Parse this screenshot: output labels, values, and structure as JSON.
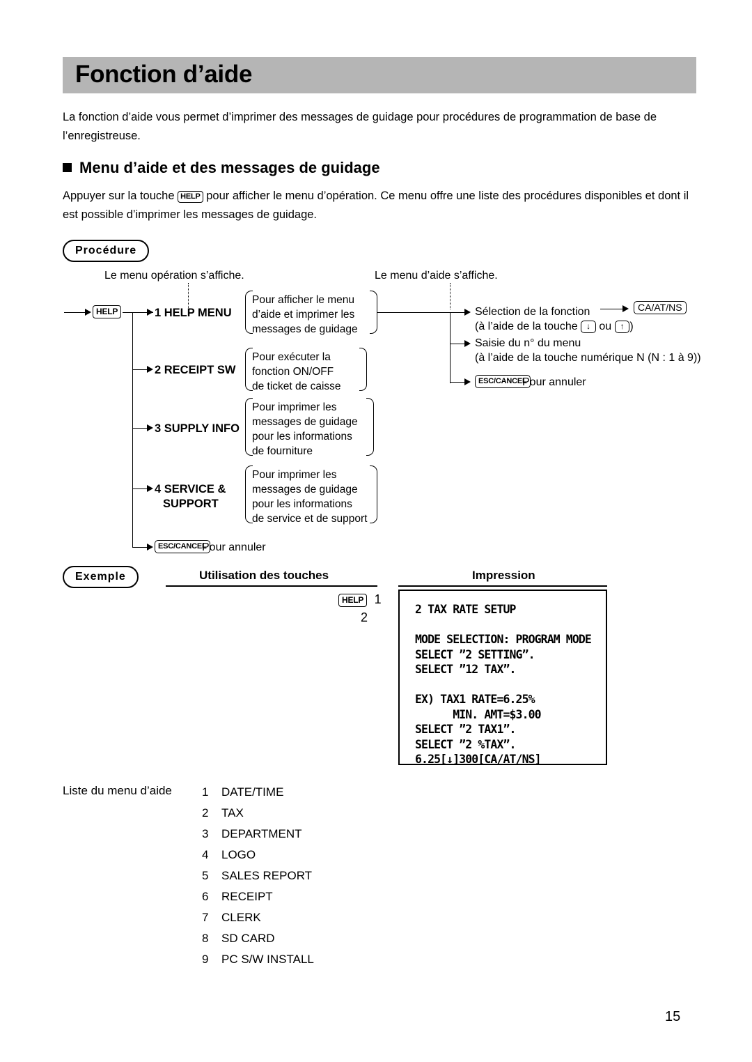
{
  "page": {
    "title": "Fonction d’aide",
    "page_number": "15"
  },
  "intro": {
    "paragraph": "La fonction d’aide vous permet d’imprimer des messages de guidage pour procédures de programmation de base de l’enregistreuse."
  },
  "section": {
    "heading": "Menu d’aide et des messages de guidage",
    "paragraph_before_key": "Appuyer sur la touche ",
    "key_label": "HELP",
    "paragraph_after_key": " pour afficher le menu d’opération. Ce menu offre une liste des procédures disponibles et dont il est possible d’imprimer les messages de guidage."
  },
  "procedure": {
    "pill_label": "Procédure",
    "caption_left": "Le menu opération s’affiche.",
    "caption_right": "Le menu d’aide s’affiche.",
    "start_key": "HELP",
    "menu_items": [
      {
        "label": "1 HELP MENU",
        "description": "Pour afficher le menu\nd’aide et imprimer les\nmessages de guidage"
      },
      {
        "label": "2 RECEIPT SW",
        "description": "Pour exécuter la\nfonction ON/OFF\nde ticket de caisse"
      },
      {
        "label": "3 SUPPLY INFO",
        "description": "Pour imprimer les\nmessages de guidage\npour les informations\nde fourniture"
      },
      {
        "label_line1": "4 SERVICE &",
        "label_line2": "SUPPORT",
        "description": "Pour imprimer les\nmessages de guidage\npour les informations\nde service et de support"
      }
    ],
    "cancel_left": {
      "key": "ESC/CANCEL",
      "text": "Pour annuler"
    },
    "right_branches": [
      {
        "line1": "Sélection de la fonction",
        "line2_before": "(à l’aide de la touche ",
        "key_down": "↓",
        "line2_mid": " ou ",
        "key_up": "↑",
        "line2_after": ")",
        "result_key": "CA/AT/NS"
      },
      {
        "line1": "Saisie du n° du menu",
        "line2": "(à l’aide de la touche numérique N (N : 1 à 9))"
      }
    ],
    "cancel_right": {
      "key": "ESC/CANCEL",
      "text": "Pour annuler"
    }
  },
  "example": {
    "pill_label": "Exemple",
    "col_keys_header": "Utilisation des touches",
    "col_print_header": "Impression",
    "key_sequence": [
      {
        "key": "HELP",
        "step": "1"
      },
      {
        "key": "",
        "step": "2"
      }
    ],
    "receipt": "2 TAX RATE SETUP\n\nMODE SELECTION: PROGRAM MODE\nSELECT ”2 SETTING”.\nSELECT ”12 TAX”.\n\nEX) TAX1 RATE=6.25%\n      MIN. AMT=$3.00\nSELECT ”2 TAX1”.\nSELECT ”2 %TAX”.\n6.25[↓]300[CA/AT/NS]"
  },
  "help_menu_list": {
    "label": "Liste du menu d’aide",
    "items": [
      {
        "num": "1",
        "label": "DATE/TIME"
      },
      {
        "num": "2",
        "label": "TAX"
      },
      {
        "num": "3",
        "label": "DEPARTMENT"
      },
      {
        "num": "4",
        "label": "LOGO"
      },
      {
        "num": "5",
        "label": "SALES REPORT"
      },
      {
        "num": "6",
        "label": "RECEIPT"
      },
      {
        "num": "7",
        "label": "CLERK"
      },
      {
        "num": "8",
        "label": "SD CARD"
      },
      {
        "num": "9",
        "label": "PC S/W INSTALL"
      }
    ]
  },
  "colors": {
    "title_bar": "#b5b5b5",
    "text": "#000000",
    "page_background": "#ffffff"
  }
}
